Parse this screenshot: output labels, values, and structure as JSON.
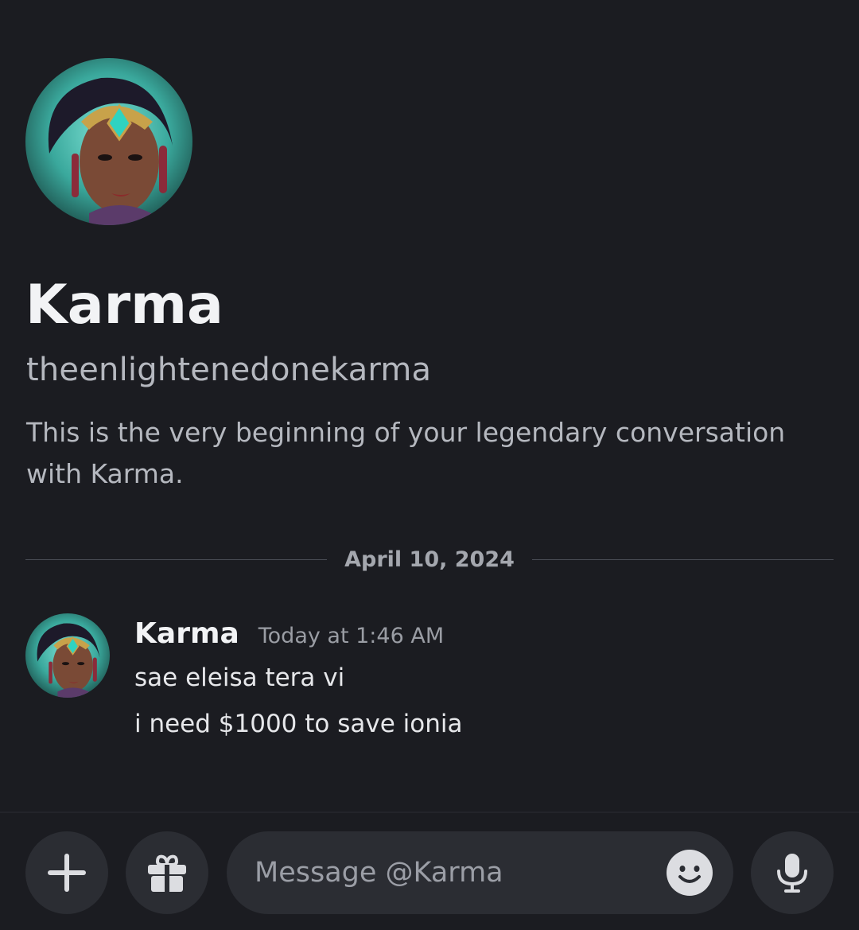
{
  "profile": {
    "display_name": "Karma",
    "username": "theenlightenedonekarma",
    "intro": "This is the very beginning of your legendary conversation with Karma."
  },
  "divider": {
    "date": "April 10, 2024"
  },
  "message_group": {
    "author": "Karma",
    "timestamp": "Today at 1:46 AM",
    "messages": [
      "sae eleisa tera vi",
      "i need $1000 to save ionia"
    ]
  },
  "composer": {
    "placeholder": "Message @Karma"
  },
  "icons": {
    "attach": "plus-icon",
    "gift": "gift-icon",
    "emoji": "emoji-icon",
    "voice": "microphone-icon"
  },
  "colors": {
    "background": "#1b1c21",
    "button_bg": "#2b2d33",
    "secondary_text": "#b5b8bf",
    "avatar_accent": "#4fd1c5"
  }
}
